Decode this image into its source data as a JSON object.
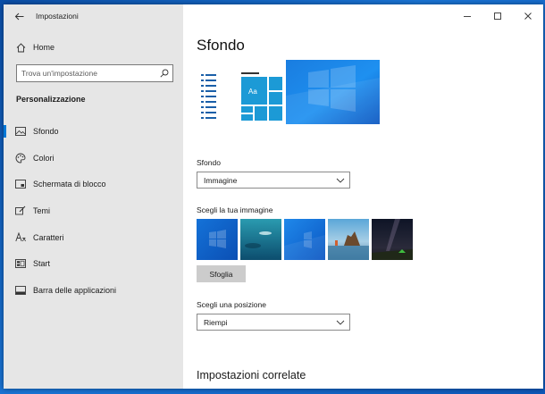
{
  "window": {
    "app_title": "Impostazioni",
    "controls": {
      "minimize": "minimize-icon",
      "maximize": "maximize-icon",
      "close": "close-icon"
    }
  },
  "sidebar": {
    "home_label": "Home",
    "search_placeholder": "Trova un'impostazione",
    "section_header": "Personalizzazione",
    "items": [
      {
        "label": "Sfondo",
        "icon": "picture-icon",
        "active": true
      },
      {
        "label": "Colori",
        "icon": "palette-icon",
        "active": false
      },
      {
        "label": "Schermata di blocco",
        "icon": "lock-screen-icon",
        "active": false
      },
      {
        "label": "Temi",
        "icon": "brush-icon",
        "active": false
      },
      {
        "label": "Caratteri",
        "icon": "font-icon",
        "active": false
      },
      {
        "label": "Start",
        "icon": "start-icon",
        "active": false
      },
      {
        "label": "Barra delle applicazioni",
        "icon": "taskbar-icon",
        "active": false
      }
    ]
  },
  "main": {
    "title": "Sfondo",
    "preview_sample_text": "Aa",
    "background_label": "Sfondo",
    "background_value": "Immagine",
    "choose_image_label": "Scegli la tua immagine",
    "browse_label": "Sfoglia",
    "position_label": "Scegli una posizione",
    "position_value": "Riempi",
    "related_heading": "Impostazioni correlate"
  },
  "colors": {
    "accent": "#0078d7",
    "sidebar_bg": "#e6e6e6",
    "preview_tile": "#1c9ad6"
  }
}
